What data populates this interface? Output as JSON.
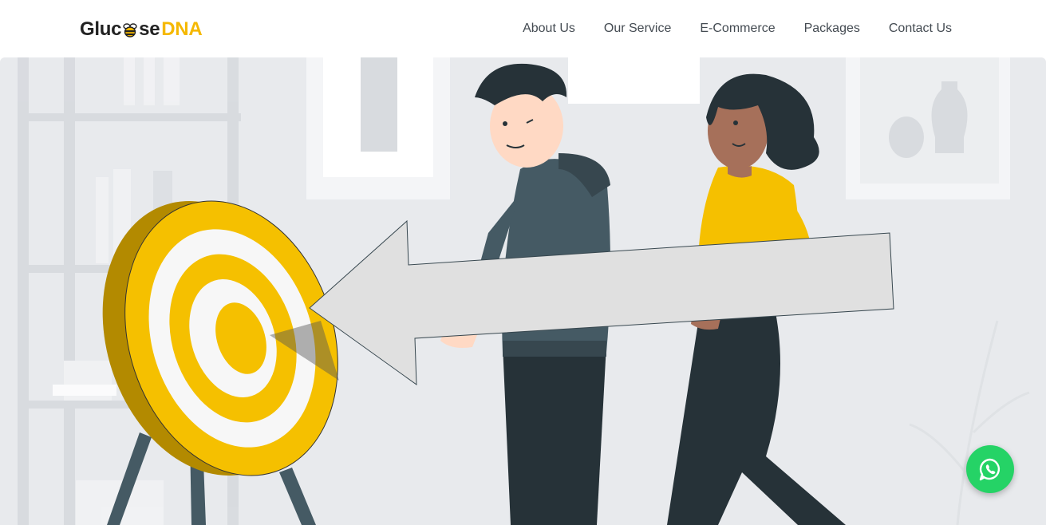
{
  "brand": {
    "logo_part_a": "Gluc",
    "logo_part_b": "se",
    "logo_part_c": "DNA",
    "accent_color": "#f5b800"
  },
  "nav": {
    "items": [
      {
        "label": "About Us"
      },
      {
        "label": "Our Service"
      },
      {
        "label": "E-Commerce"
      },
      {
        "label": "Packages"
      },
      {
        "label": "Contact Us"
      }
    ]
  },
  "hero": {
    "illustration": "two people carrying an arrow toward a dartboard target"
  },
  "floating": {
    "icon": "whatsapp-icon",
    "color": "#25d366"
  }
}
